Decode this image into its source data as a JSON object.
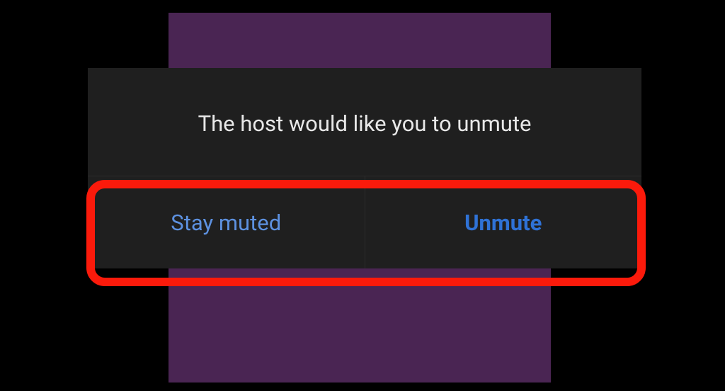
{
  "dialog": {
    "message": "The host would like you to unmute",
    "stay_muted_label": "Stay muted",
    "unmute_label": "Unmute"
  },
  "colors": {
    "background": "#000000",
    "backdrop": "#4a2553",
    "dialog_bg": "#1f1f1f",
    "text": "#e8e8e8",
    "button_normal": "#5d91e0",
    "button_bold": "#2f72d6",
    "annotation": "#fb1a0b"
  }
}
